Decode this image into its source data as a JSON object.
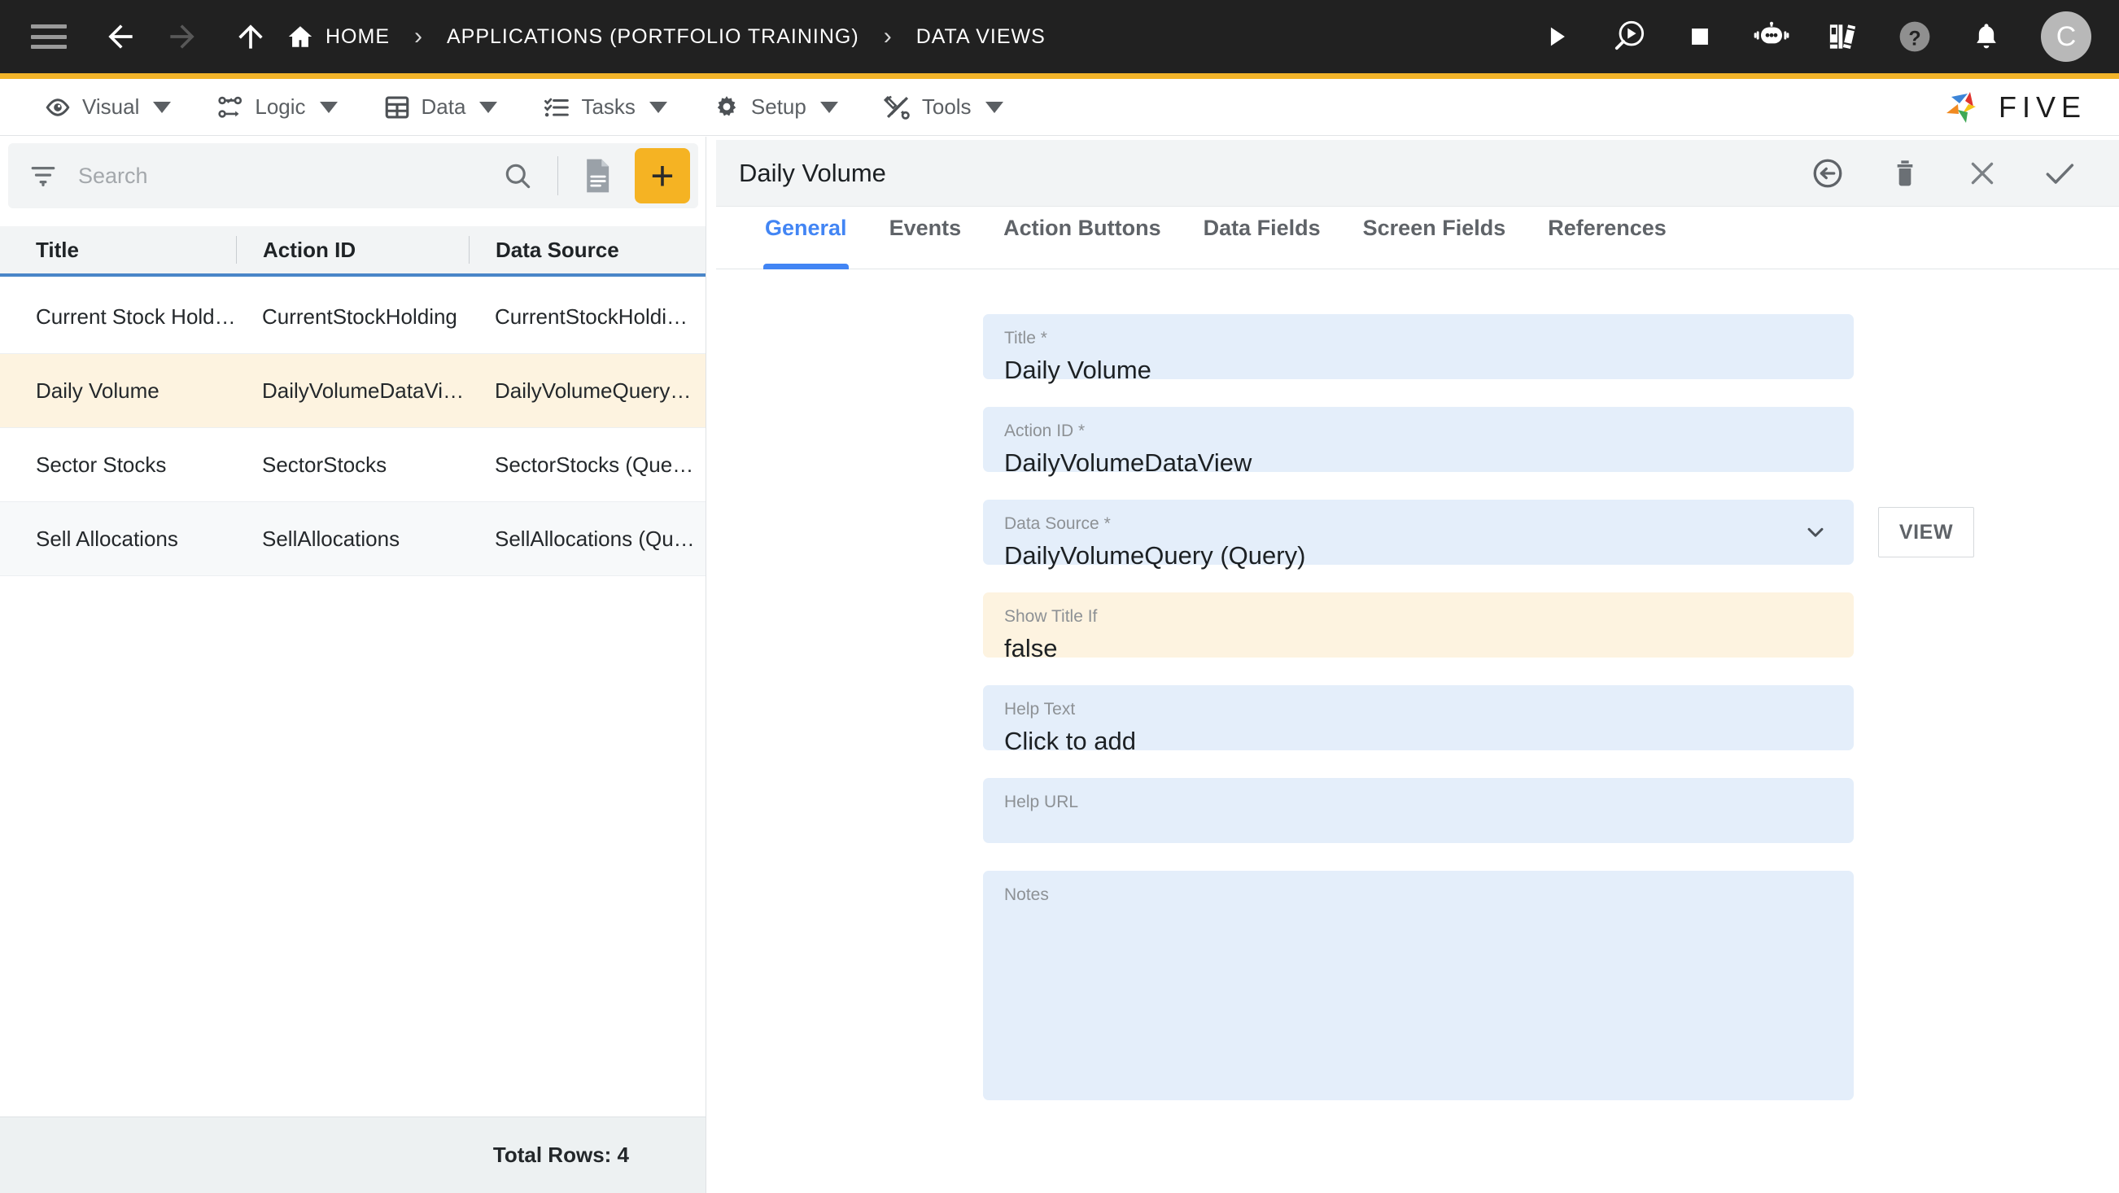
{
  "topbar": {
    "menu_icon": "hamburger-icon",
    "back_icon": "arrow-left-icon",
    "forward_icon": "arrow-right-icon",
    "up_icon": "arrow-up-icon",
    "home_label": "HOME",
    "breadcrumbs": [
      {
        "label": "APPLICATIONS (PORTFOLIO TRAINING)"
      },
      {
        "label": "DATA VIEWS"
      }
    ],
    "separator": "›",
    "actions": [
      {
        "name": "run-icon"
      },
      {
        "name": "debug-icon"
      },
      {
        "name": "stop-icon"
      },
      {
        "name": "chatbot-icon"
      },
      {
        "name": "library-icon"
      },
      {
        "name": "help-icon"
      },
      {
        "name": "notifications-icon"
      }
    ],
    "avatar_initial": "C"
  },
  "menubar": {
    "items": [
      {
        "label": "Visual",
        "icon": "eye-icon"
      },
      {
        "label": "Logic",
        "icon": "flow-icon"
      },
      {
        "label": "Data",
        "icon": "table-icon"
      },
      {
        "label": "Tasks",
        "icon": "checklist-icon"
      },
      {
        "label": "Setup",
        "icon": "gear-icon"
      },
      {
        "label": "Tools",
        "icon": "tools-icon"
      }
    ],
    "logo_text": "FIVE"
  },
  "left_panel": {
    "search": {
      "placeholder": "Search",
      "value": "",
      "filter_icon": "filter-icon",
      "search_icon": "search-icon",
      "document_icon": "document-icon",
      "add_label": "+"
    },
    "table": {
      "columns": [
        "Title",
        "Action ID",
        "Data Source"
      ],
      "rows": [
        {
          "title": "Current Stock Hold…",
          "action_id": "CurrentStockHolding",
          "data_source": "CurrentStockHoldi…",
          "selected": false
        },
        {
          "title": "Daily Volume",
          "action_id": "DailyVolumeDataVi…",
          "data_source": "DailyVolumeQuery …",
          "selected": true
        },
        {
          "title": "Sector Stocks",
          "action_id": "SectorStocks",
          "data_source": "SectorStocks (Quer…",
          "selected": false
        },
        {
          "title": "Sell Allocations",
          "action_id": "SellAllocations",
          "data_source": "SellAllocations (Qu…",
          "selected": false
        }
      ]
    },
    "footer": {
      "total_rows": "Total Rows: 4"
    }
  },
  "right_panel": {
    "title": "Daily Volume",
    "header_actions": [
      {
        "name": "revert-icon"
      },
      {
        "name": "delete-icon"
      },
      {
        "name": "close-icon"
      },
      {
        "name": "save-icon"
      }
    ],
    "tabs": [
      {
        "label": "General",
        "active": true
      },
      {
        "label": "Events",
        "active": false
      },
      {
        "label": "Action Buttons",
        "active": false
      },
      {
        "label": "Data Fields",
        "active": false
      },
      {
        "label": "Screen Fields",
        "active": false
      },
      {
        "label": "References",
        "active": false
      }
    ],
    "form": {
      "title_field": {
        "label": "Title *",
        "value": "Daily Volume"
      },
      "action_id_field": {
        "label": "Action ID *",
        "value": "DailyVolumeDataView"
      },
      "data_source_field": {
        "label": "Data Source *",
        "value": "DailyVolumeQuery (Query)",
        "view_button": "VIEW"
      },
      "show_title_if_field": {
        "label": "Show Title If",
        "value": "false"
      },
      "help_text_field": {
        "label": "Help Text",
        "value": "Click to add"
      },
      "help_url_field": {
        "label": "Help URL",
        "value": ""
      },
      "notes_field": {
        "label": "Notes",
        "value": ""
      }
    }
  },
  "colors": {
    "topbar_bg": "#212121",
    "accent_yellow": "#f2b42a",
    "add_button": "#f5b323",
    "tab_active": "#4285f4",
    "selected_row": "#fdf3e0",
    "field_bg": "#e4eefa",
    "field_warn_bg": "#fdf3e0"
  }
}
